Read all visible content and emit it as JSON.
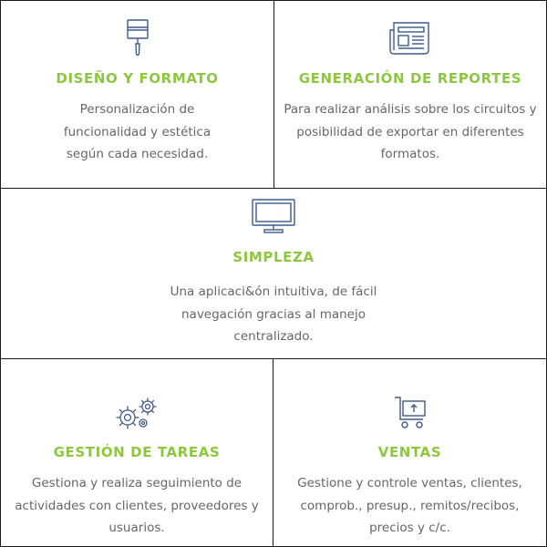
{
  "features": [
    {
      "icon": "paint-brush-icon",
      "title": "DISEÑO Y FORMATO",
      "lines": [
        "Personalización de",
        "funcionalidad y estética",
        "según cada necesidad."
      ]
    },
    {
      "icon": "newspaper-icon",
      "title": "GENERACIÓN DE REPORTES",
      "lines": [
        "Para realizar análisis sobre los circuitos y",
        "posibilidad de exportar en diferentes",
        "formatos."
      ]
    },
    {
      "icon": "monitor-icon",
      "title": "SIMPLEZA",
      "lines": [
        "Una aplicaci&ón intuitiva, de fácil",
        "navegación gracias al manejo",
        "centralizado."
      ]
    },
    {
      "icon": "gears-icon",
      "title": "GESTIÓN DE TAREAS",
      "lines": [
        "Gestiona y realiza seguimiento de",
        "actividades con clientes, proveedores y",
        "usuarios."
      ]
    },
    {
      "icon": "shopping-cart-icon",
      "title": "VENTAS",
      "lines": [
        "Gestione y controle ventas, clientes,",
        "comprob., presup., remitos/recibos,",
        "precios y c/c."
      ]
    }
  ],
  "colors": {
    "accent": "#8dc63f",
    "icon": "#3d5a8a",
    "text": "#666666",
    "border": "#1a1a1a"
  }
}
